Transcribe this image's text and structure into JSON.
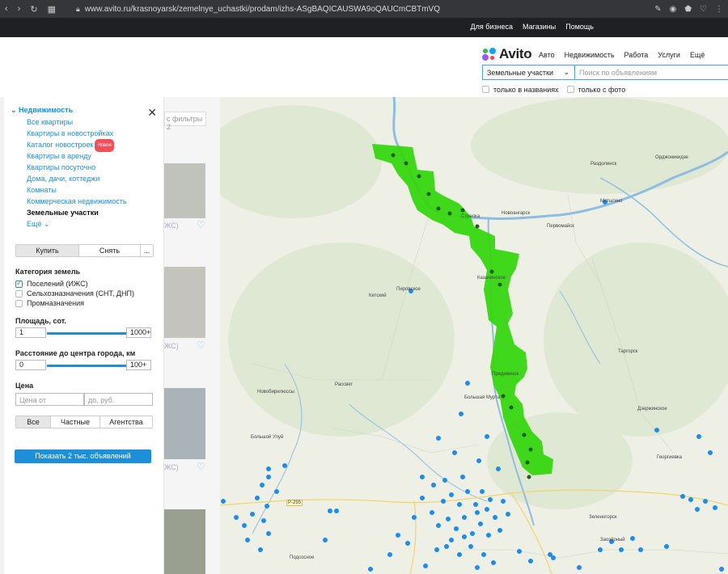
{
  "browser": {
    "url": "www.avito.ru/krasnoyarsk/zemelnye_uchastki/prodam/izhs-ASgBAQICAUSWA9oQAUCmCBTmVQ"
  },
  "topbar": {
    "links": [
      "Для бизнеса",
      "Магазины",
      "Помощь"
    ]
  },
  "header": {
    "logo_text": "Avito",
    "menu": [
      "Авто",
      "Недвижимость",
      "Работа",
      "Услуги",
      "Ещё"
    ],
    "category_select": "Земельные участки",
    "search_placeholder": "Поиск по объявлениям",
    "check_titles_only": "только в названиях",
    "check_with_photo": "только с фото"
  },
  "panel": {
    "category_title": "Недвижимость",
    "subcategories": [
      "Все квартиры",
      "Квартиры в новостройках",
      "Каталог новостроек",
      "Квартиры в аренду",
      "Квартиры посуточно",
      "Дома, дачи, коттеджи",
      "Комнаты",
      "Коммерческая недвижимость",
      "Земельные участки",
      "Ещё"
    ],
    "new_badge": "Новое",
    "deal_types": [
      "Купить",
      "Снять",
      "..."
    ],
    "land_category_label": "Категория земель",
    "land_options": [
      "Поселений (ИЖС)",
      "Сельхозназначения (СНТ, ДНП)",
      "Промназначения"
    ],
    "land_checked": [
      true,
      false,
      false
    ],
    "area_label": "Площадь, сот.",
    "area_from": "1",
    "area_to": "1000+",
    "distance_label": "Расстояние до центра города, км",
    "distance_from": "0",
    "distance_to": "100+",
    "price_label": "Цена",
    "price_from_placeholder": "Цена от",
    "price_to_placeholder": "до, руб.",
    "seller_types": [
      "Все",
      "Частные",
      "Агентства"
    ],
    "show_button": "Показать 2 тыс. объявлений"
  },
  "listing": {
    "filters_chip": "с фильтры 2",
    "tags": [
      "ЖС)",
      "ЖС)",
      "ЖС)"
    ]
  },
  "map": {
    "places": [
      "Раздолинск",
      "Орджоникидзе",
      "Мотыгино",
      "Новоангарск",
      "Первомайск",
      "Стрелка",
      "Казачинское",
      "Пировское",
      "Кетский",
      "Таргорск",
      "Предивинск",
      "Рассвет",
      "Новобирилюссы",
      "Большая Мурта",
      "Дзержинское",
      "Большой Улуй",
      "Георгиевка",
      "Зеленогорск",
      "Подсосное",
      "Заозёрный",
      "Р-255"
    ],
    "colors": {
      "route": "#36d60f",
      "pin": "#1b8cf0",
      "river": "#8fbde0",
      "land": "#eef0e6"
    }
  }
}
